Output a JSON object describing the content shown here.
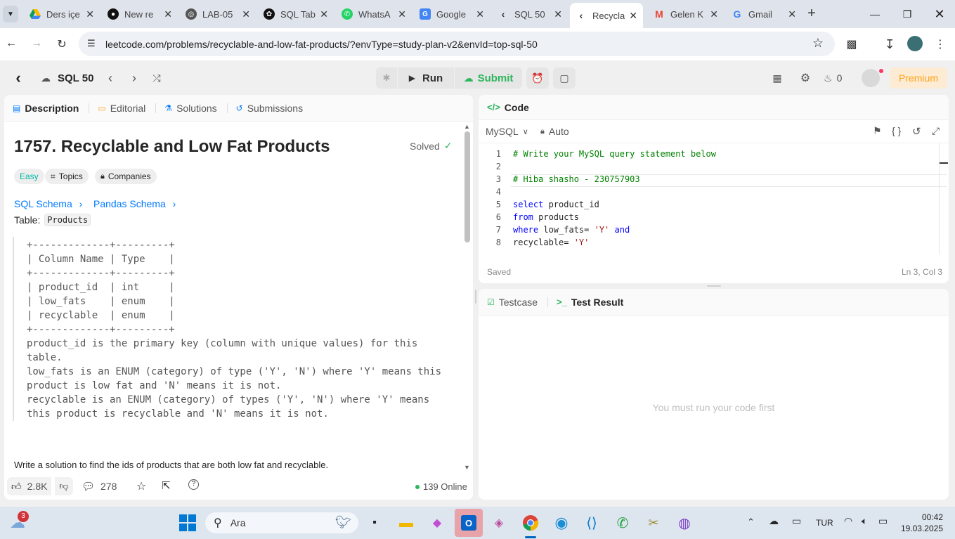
{
  "browser": {
    "tabs": [
      {
        "title": "Ders içe",
        "icon": "google-drive-icon",
        "color": "#1fa463"
      },
      {
        "title": "New re",
        "icon": "github-icon",
        "color": "#000000"
      },
      {
        "title": "LAB-05",
        "icon": "globe-icon",
        "color": "#555555"
      },
      {
        "title": "SQL Tab",
        "icon": "openai-icon",
        "color": "#000000"
      },
      {
        "title": "WhatsA",
        "icon": "whatsapp-icon",
        "color": "#25d366"
      },
      {
        "title": "Google",
        "icon": "google-translate-icon",
        "color": "#4285f4"
      },
      {
        "title": "SQL 50",
        "icon": "leetcode-icon",
        "color": "#333333"
      },
      {
        "title": "Recycla",
        "icon": "leetcode-icon",
        "color": "#333333",
        "active": true
      },
      {
        "title": "Gelen K",
        "icon": "gmail-icon",
        "color": "#ea4335"
      },
      {
        "title": "Gmail",
        "icon": "google-icon",
        "color": "#4285f4"
      }
    ],
    "url": "leetcode.com/problems/recyclable-and-low-fat-products/?envType=study-plan-v2&envId=top-sql-50"
  },
  "header": {
    "study_plan": "SQL 50",
    "run_label": "Run",
    "submit_label": "Submit",
    "streak": "0",
    "premium_label": "Premium"
  },
  "left_tabs": {
    "description": "Description",
    "editorial": "Editorial",
    "solutions": "Solutions",
    "submissions": "Submissions"
  },
  "problem": {
    "title": "1757. Recyclable and Low Fat Products",
    "solved_label": "Solved",
    "difficulty": "Easy",
    "topics_label": "Topics",
    "companies_label": "Companies",
    "sql_schema": "SQL Schema",
    "pandas_schema": "Pandas Schema",
    "table_prefix": "Table: ",
    "table_name": "Products",
    "schema_text": "+-------------+---------+\n| Column Name | Type    |\n+-------------+---------+\n| product_id  | int     |\n| low_fats    | enum    |\n| recyclable  | enum    |\n+-------------+---------+\nproduct_id is the primary key (column with unique values) for this\ntable.\nlow_fats is an ENUM (category) of type ('Y', 'N') where 'Y' means this\nproduct is low fat and 'N' means it is not.\nrecyclable is an ENUM (category) of types ('Y', 'N') where 'Y' means\nthis product is recyclable and 'N' means it is not.",
    "prompt": "Write a solution to find the ids of products that are both low fat and recyclable."
  },
  "footer": {
    "likes": "2.8K",
    "comments": "278",
    "online": "139 Online"
  },
  "code_panel": {
    "title": "Code",
    "language": "MySQL",
    "mode": "Auto",
    "status": "Saved",
    "cursor": "Ln 3, Col 3",
    "lines": [
      {
        "n": "1",
        "text": "# Write your MySQL query statement below"
      },
      {
        "n": "2",
        "text": ""
      },
      {
        "n": "3",
        "text": "# Hiba shasho - 230757903"
      },
      {
        "n": "4",
        "text": ""
      },
      {
        "n": "5",
        "text": "select product_id"
      },
      {
        "n": "6",
        "text": "from products"
      },
      {
        "n": "7",
        "text": "where low_fats= 'Y' and"
      },
      {
        "n": "8",
        "text": "recyclable= 'Y'"
      }
    ]
  },
  "result_panel": {
    "testcase_label": "Testcase",
    "result_label": "Test Result",
    "empty_message": "You must run your code first"
  },
  "taskbar": {
    "weather_badge": "3",
    "search_placeholder": "Ara",
    "language": "TUR",
    "time": "00:42",
    "date": "19.03.2025"
  }
}
